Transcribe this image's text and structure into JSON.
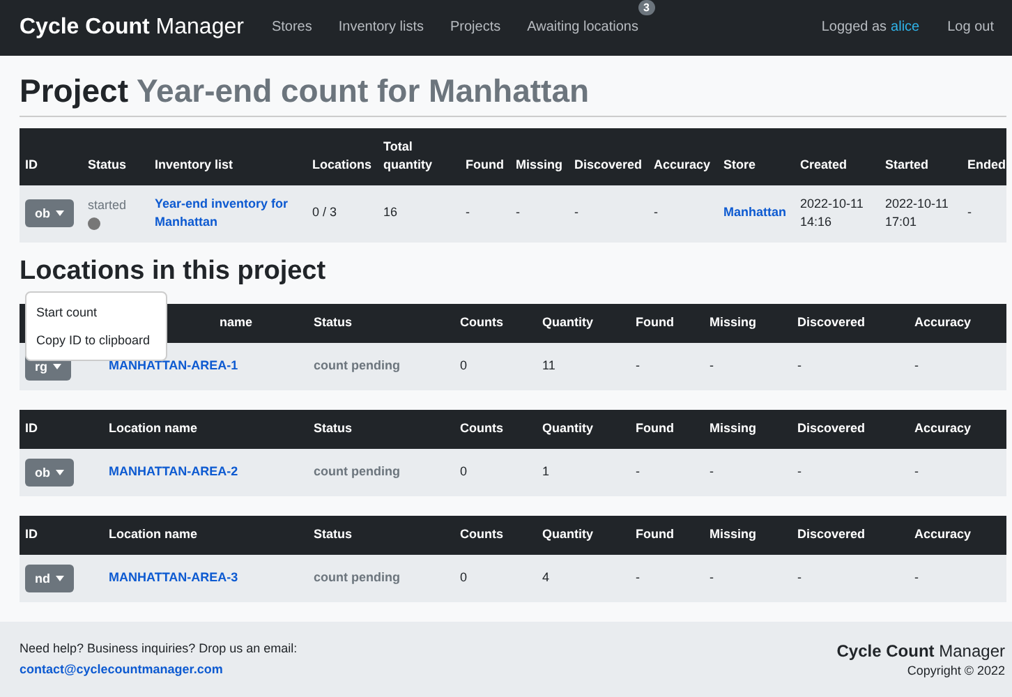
{
  "navbar": {
    "brand_bold": "Cycle Count",
    "brand_light": "Manager",
    "links": [
      {
        "label": "Stores"
      },
      {
        "label": "Inventory lists"
      },
      {
        "label": "Projects"
      },
      {
        "label": "Awaiting locations",
        "badge": "3"
      }
    ],
    "logged_as": "Logged as",
    "user": "alice",
    "logout": "Log out"
  },
  "heading": {
    "prefix": "Project",
    "name": "Year-end count for Manhattan"
  },
  "project_table": {
    "columns": [
      "ID",
      "Status",
      "Inventory list",
      "Locations",
      "Total quantity",
      "Found",
      "Missing",
      "Discovered",
      "Accuracy",
      "Store",
      "Created",
      "Started",
      "Ended"
    ],
    "row": {
      "id": "ob",
      "status": "started",
      "inventory_list": "Year-end inventory for Manhattan",
      "locations": "0 / 3",
      "total_quantity": "16",
      "found": "-",
      "missing": "-",
      "discovered": "-",
      "accuracy": "-",
      "store": "Manhattan",
      "created": "2022-10-11 14:16",
      "started": "2022-10-11 17:01",
      "ended": "-"
    }
  },
  "locations_heading": "Locations in this project",
  "locations": [
    {
      "columns": [
        null,
        "name",
        "Status",
        "Counts",
        "Quantity",
        "Found",
        "Missing",
        "Discovered",
        "Accuracy"
      ],
      "id": "rg",
      "name": "MANHATTAN-AREA-1",
      "status": "count pending",
      "counts": "0",
      "quantity": "11",
      "found": "-",
      "missing": "-",
      "discovered": "-",
      "accuracy": "-",
      "menu": [
        "Start count",
        "Copy ID to clipboard"
      ]
    },
    {
      "columns": [
        "ID",
        "Location name",
        "Status",
        "Counts",
        "Quantity",
        "Found",
        "Missing",
        "Discovered",
        "Accuracy"
      ],
      "id": "ob",
      "name": "MANHATTAN-AREA-2",
      "status": "count pending",
      "counts": "0",
      "quantity": "1",
      "found": "-",
      "missing": "-",
      "discovered": "-",
      "accuracy": "-"
    },
    {
      "columns": [
        "ID",
        "Location name",
        "Status",
        "Counts",
        "Quantity",
        "Found",
        "Missing",
        "Discovered",
        "Accuracy"
      ],
      "id": "nd",
      "name": "MANHATTAN-AREA-3",
      "status": "count pending",
      "counts": "0",
      "quantity": "4",
      "found": "-",
      "missing": "-",
      "discovered": "-",
      "accuracy": "-"
    }
  ],
  "footer": {
    "help": "Need help? Business inquiries? Drop us an email:",
    "email": "contact@cyclecountmanager.com",
    "brand_bold": "Cycle Count",
    "brand_light": "Manager",
    "copyright": "Copyright © 2022"
  }
}
